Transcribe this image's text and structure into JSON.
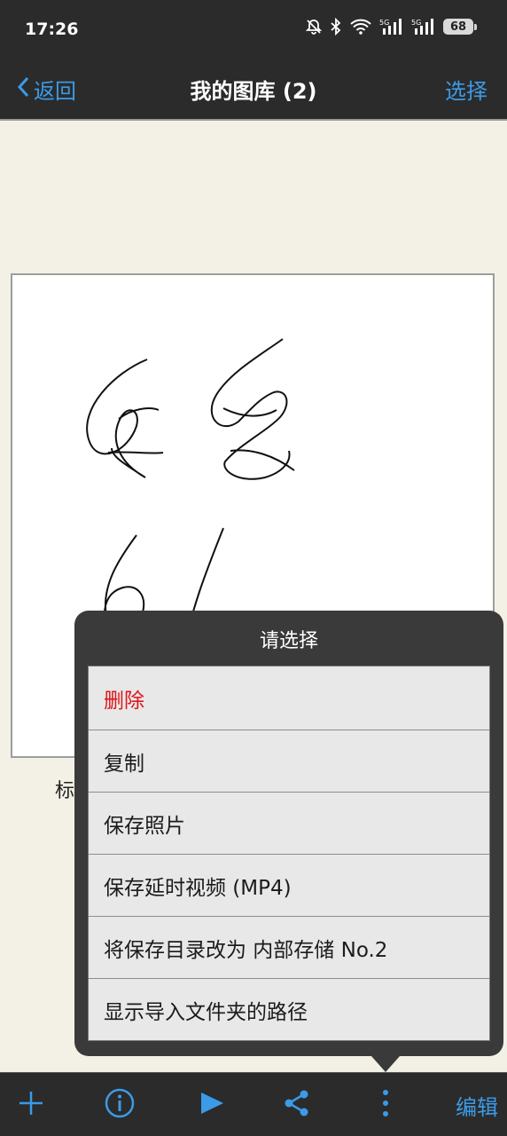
{
  "status_bar": {
    "time": "17:26",
    "icons": [
      "bell-off-icon",
      "bluetooth-icon",
      "wifi-icon",
      "signal-5g-icon",
      "signal-5g-icon"
    ],
    "battery": "68"
  },
  "nav": {
    "back_label": "返回",
    "title": "我的图库 (2)",
    "select_label": "选择"
  },
  "gallery": {
    "caption": "标题"
  },
  "popover": {
    "title": "请选择",
    "items": [
      {
        "label": "删除",
        "destructive": true
      },
      {
        "label": "复制"
      },
      {
        "label": "保存照片"
      },
      {
        "label": "保存延时视频 (MP4)"
      },
      {
        "label": "将保存目录改为 内部存储 No.2"
      },
      {
        "label": "显示导入文件夹的路径"
      }
    ]
  },
  "toolbar": {
    "icons": [
      "add-icon",
      "info-icon",
      "play-icon",
      "share-icon",
      "more-vertical-icon"
    ],
    "edit_label": "编辑"
  },
  "colors": {
    "accent": "#3b9be8",
    "destructive": "#e0141a",
    "bar_background": "#2b2b2b",
    "page_background": "#f3f1e6"
  }
}
